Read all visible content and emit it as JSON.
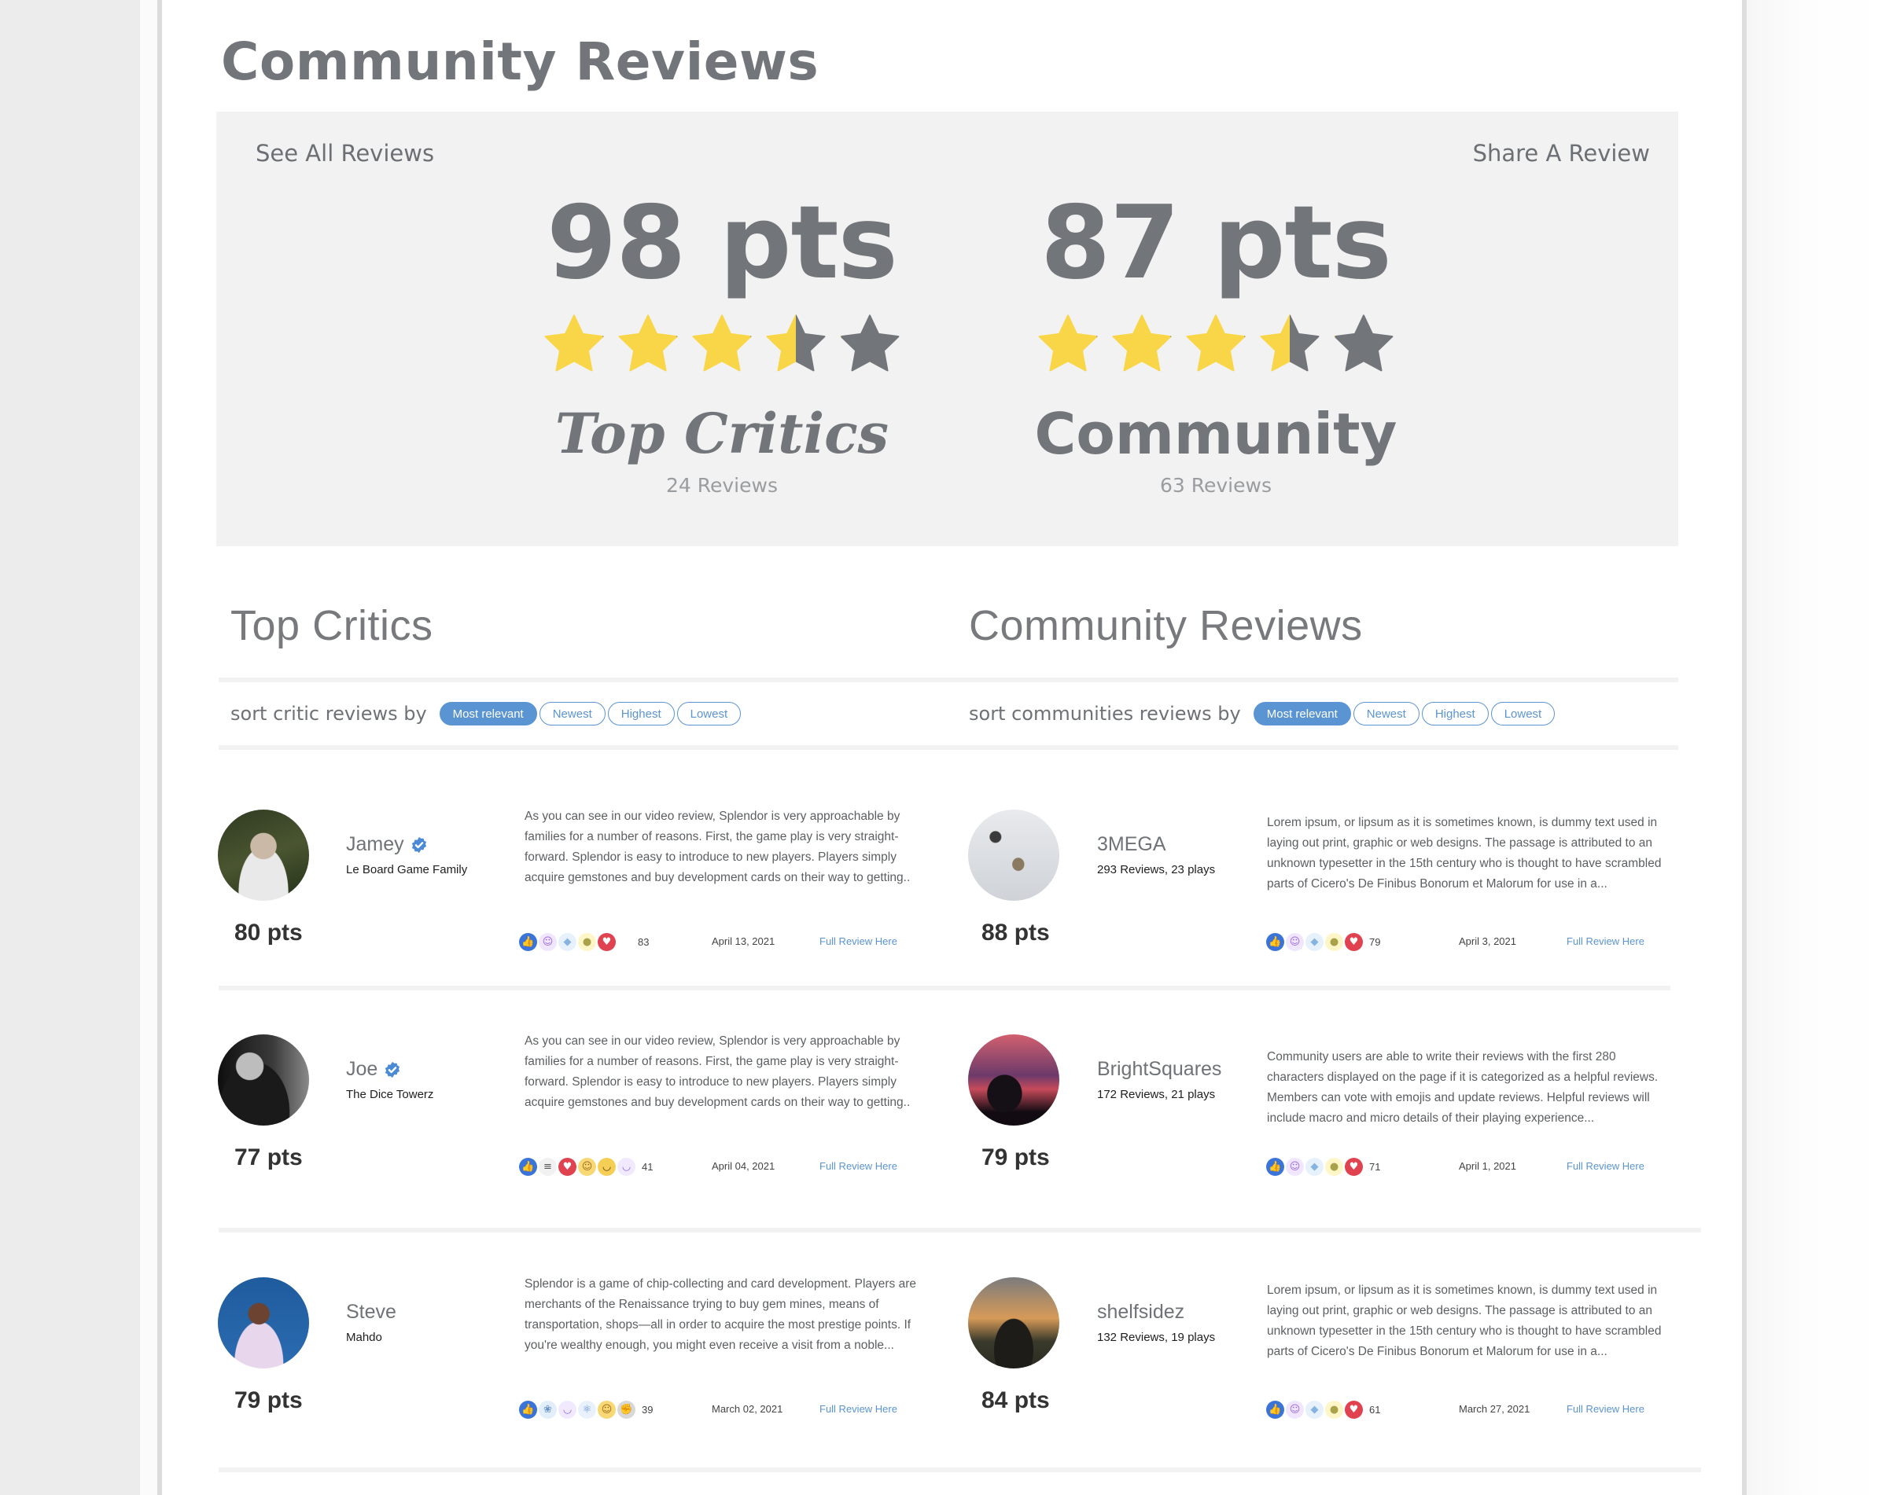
{
  "page_title": "Community Reviews",
  "summary": {
    "see_all_label": "See All Reviews",
    "share_label": "Share A Review",
    "critics": {
      "score": "98 pts",
      "rating": 3.5,
      "label": "Top Critics",
      "count": "24 Reviews"
    },
    "community": {
      "score": "87 pts",
      "rating": 3.5,
      "label": "Community",
      "count": "63 Reviews"
    }
  },
  "colors": {
    "star_filled": "#f8d648",
    "star_empty": "#72767a",
    "accent": "#5b94d3",
    "summary_bg": "#f2f2f2"
  },
  "critics_section": {
    "title": "Top Critics",
    "sort_label": "sort critic reviews by",
    "sort_options": [
      "Most relevant",
      "Newest",
      "Highest",
      "Lowest"
    ],
    "active_sort": "Most relevant",
    "reviews": [
      {
        "name": "Jamey",
        "verified": true,
        "subtitle": "Le Board Game Family",
        "points": "80 pts",
        "text": "As you can see in our video review, Splendor is very approachable by families for a number of reasons. First, the game play is very straight-forward. Splendor is easy to introduce to new players. Players simply acquire gemstones and buy development cards on their way to getting..",
        "reactions": [
          "thumbs-up",
          "robot-mask",
          "diamond",
          "lightbulb",
          "heart"
        ],
        "reaction_count": "83",
        "date": "April 13, 2021",
        "link": "Full Review Here"
      },
      {
        "name": "Joe",
        "verified": true,
        "subtitle": "The Dice Towerz",
        "points": "77 pts",
        "text": "As you can see in our video review, Splendor is very approachable by families for a number of reasons. First, the game play is very straight-forward. Splendor is easy to introduce to new players. Players simply acquire gemstones and buy development cards on their way to getting..",
        "reactions": [
          "thumbs-up",
          "mummy",
          "heart",
          "smile",
          "laugh",
          "happy-ghost"
        ],
        "reaction_count": "41",
        "date": "April 04, 2021",
        "link": "Full Review Here"
      },
      {
        "name": "Steve",
        "verified": false,
        "subtitle": "Mahdo",
        "points": "79 pts",
        "text": "Splendor is a game of chip-collecting and card development. Players are merchants of the Renaissance trying to buy gem mines, means of transportation, shops—all in order to acquire the most prestige points. If you're wealthy enough, you might even receive a visit from a noble...",
        "reactions": [
          "thumbs-up",
          "dragon",
          "happy-ghost",
          "atom",
          "smile",
          "fist"
        ],
        "reaction_count": "39",
        "date": "March 02, 2021",
        "link": "Full Review Here"
      }
    ]
  },
  "community_section": {
    "title": "Community Reviews",
    "sort_label": "sort communities reviews by",
    "sort_options": [
      "Most relevant",
      "Newest",
      "Highest",
      "Lowest"
    ],
    "active_sort": "Most relevant",
    "reviews": [
      {
        "name": "3MEGA",
        "subtitle": "293 Reviews, 23 plays",
        "points": "88 pts",
        "text": "Lorem ipsum, or lipsum as it is sometimes known, is dummy text used in laying out print, graphic or web designs. The passage is attributed to an unknown typesetter in the 15th century who is thought to have scrambled parts of Cicero's De Finibus Bonorum et Malorum for use in a...",
        "reactions": [
          "thumbs-up",
          "robot-mask",
          "diamond",
          "lightbulb",
          "heart"
        ],
        "reaction_count": "79",
        "date": "April 3, 2021",
        "link": "Full Review Here"
      },
      {
        "name": "BrightSquares",
        "subtitle": "172 Reviews, 21 plays",
        "points": "79 pts",
        "text": "Community users are able to write their reviews with the first 280 characters displayed on the page if it is categorized as a helpful reviews. Members can vote with emojis and update reviews. Helpful reviews will include macro and micro details of their playing experience...",
        "reactions": [
          "thumbs-up",
          "robot-mask",
          "diamond",
          "lightbulb",
          "heart"
        ],
        "reaction_count": "71",
        "date": "April 1, 2021",
        "link": "Full Review Here"
      },
      {
        "name": "shelfsidez",
        "subtitle": "132 Reviews, 19 plays",
        "points": "84 pts",
        "text": "Lorem ipsum, or lipsum as it is sometimes known, is dummy text used in laying out print, graphic or web designs. The passage is attributed to an unknown typesetter in the 15th century who is thought to have scrambled parts of Cicero's De Finibus Bonorum et Malorum for use in a...",
        "reactions": [
          "thumbs-up",
          "robot-mask",
          "diamond",
          "lightbulb",
          "heart"
        ],
        "reaction_count": "61",
        "date": "March 27, 2021",
        "link": "Full Review Here"
      }
    ]
  }
}
